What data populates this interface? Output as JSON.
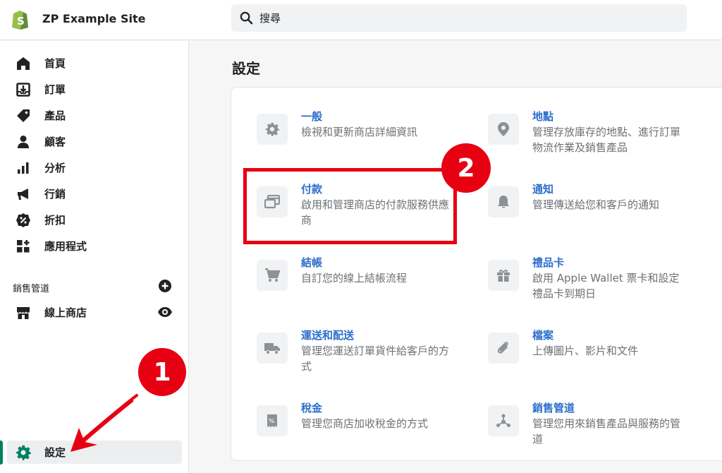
{
  "header": {
    "site_name": "ZP Example Site",
    "search_placeholder": "搜尋"
  },
  "sidebar": {
    "items": [
      {
        "label": "首頁",
        "icon": "home-icon"
      },
      {
        "label": "訂單",
        "icon": "orders-icon"
      },
      {
        "label": "產品",
        "icon": "tag-icon"
      },
      {
        "label": "顧客",
        "icon": "customer-icon"
      },
      {
        "label": "分析",
        "icon": "analytics-icon"
      },
      {
        "label": "行銷",
        "icon": "megaphone-icon"
      },
      {
        "label": "折扣",
        "icon": "discount-icon"
      },
      {
        "label": "應用程式",
        "icon": "apps-icon"
      }
    ],
    "sales_channels_label": "銷售管道",
    "online_store_label": "線上商店",
    "settings_label": "設定"
  },
  "main": {
    "title": "設定",
    "settings": [
      {
        "title": "一般",
        "desc": "檢視和更新商店詳細資訊",
        "icon": "gear-icon"
      },
      {
        "title": "地點",
        "desc": "管理存放庫存的地點、進行訂單物流作業及銷售產品",
        "icon": "location-pin-icon"
      },
      {
        "title": "付款",
        "desc": "啟用和管理商店的付款服務供應商",
        "icon": "payment-card-icon"
      },
      {
        "title": "通知",
        "desc": "管理傳送給您和客戶的通知",
        "icon": "bell-icon"
      },
      {
        "title": "結帳",
        "desc": "自訂您的線上結帳流程",
        "icon": "cart-icon"
      },
      {
        "title": "禮品卡",
        "desc": "啟用 Apple Wallet 票卡和設定禮品卡到期日",
        "icon": "gift-icon"
      },
      {
        "title": "運送和配送",
        "desc": "管理您運送訂單貨件給客戶的方式",
        "icon": "truck-icon"
      },
      {
        "title": "檔案",
        "desc": "上傳圖片、影片和文件",
        "icon": "paperclip-icon"
      },
      {
        "title": "稅金",
        "desc": "管理您商店加收稅金的方式",
        "icon": "tax-receipt-icon"
      },
      {
        "title": "銷售管道",
        "desc": "管理您用來銷售產品與服務的管道",
        "icon": "channels-icon"
      }
    ]
  },
  "annotations": {
    "badge_1": "1",
    "badge_2": "2",
    "accent_color": "#e60012"
  },
  "colors": {
    "link": "#2c6ecb",
    "active_green": "#008060",
    "icon_gray": "#8c9196"
  }
}
